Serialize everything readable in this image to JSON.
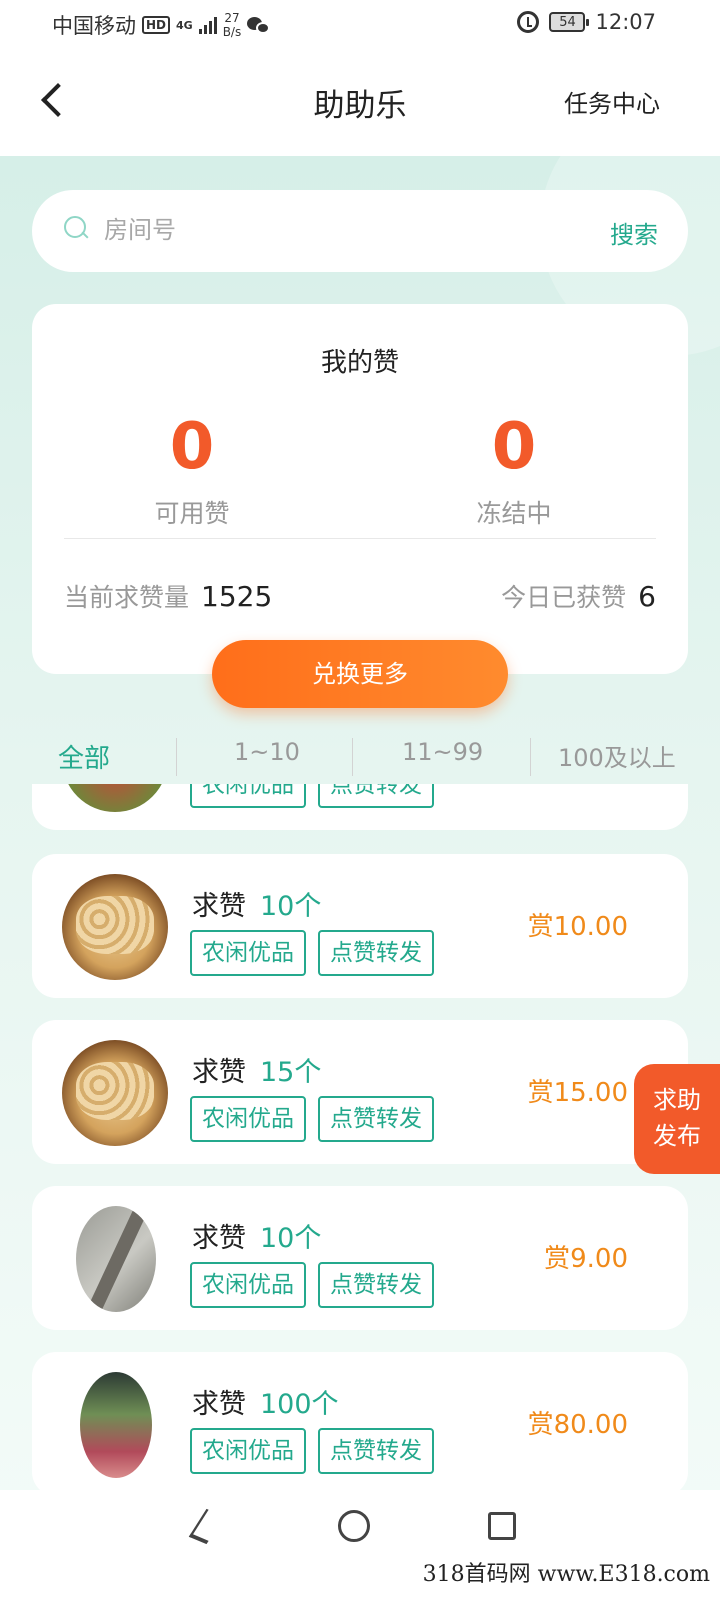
{
  "status_bar": {
    "carrier": "中国移动",
    "hd": "HD",
    "network": "4G",
    "speed_value": "27",
    "speed_unit": "B/s",
    "battery": "54",
    "time": "12:07"
  },
  "header": {
    "title": "助助乐",
    "task_center": "任务中心"
  },
  "search": {
    "placeholder": "房间号",
    "button": "搜索"
  },
  "zan_card": {
    "title": "我的赞",
    "available_value": "0",
    "available_label": "可用赞",
    "frozen_value": "0",
    "frozen_label": "冻结中",
    "current_request_label": "当前求赞量",
    "current_request_value": "1525",
    "today_earned_label": "今日已获赞",
    "today_earned_value": "6"
  },
  "exchange_button": "兑换更多",
  "tabs": [
    "全部",
    "1~10",
    "11~99",
    "100及以上"
  ],
  "tag_labels": [
    "农闲优品",
    "点赞转发"
  ],
  "request_prefix": "求赞",
  "items": [
    {
      "thumb": "apple",
      "count": "",
      "reward": ""
    },
    {
      "thumb": "peanut",
      "count": "10个",
      "reward": "赏10.00"
    },
    {
      "thumb": "peanut",
      "count": "15个",
      "reward": "赏15.00"
    },
    {
      "thumb": "grey",
      "count": "10个",
      "reward": "赏9.00"
    },
    {
      "thumb": "onion",
      "count": "100个",
      "reward": "赏80.00"
    }
  ],
  "float_button": {
    "line1": "求助",
    "line2": "发布"
  },
  "watermark": "318首码网 www.E318.com",
  "colors": {
    "accent": "#24a98d",
    "orange": "#f25a2a",
    "reward": "#f08a1a"
  }
}
